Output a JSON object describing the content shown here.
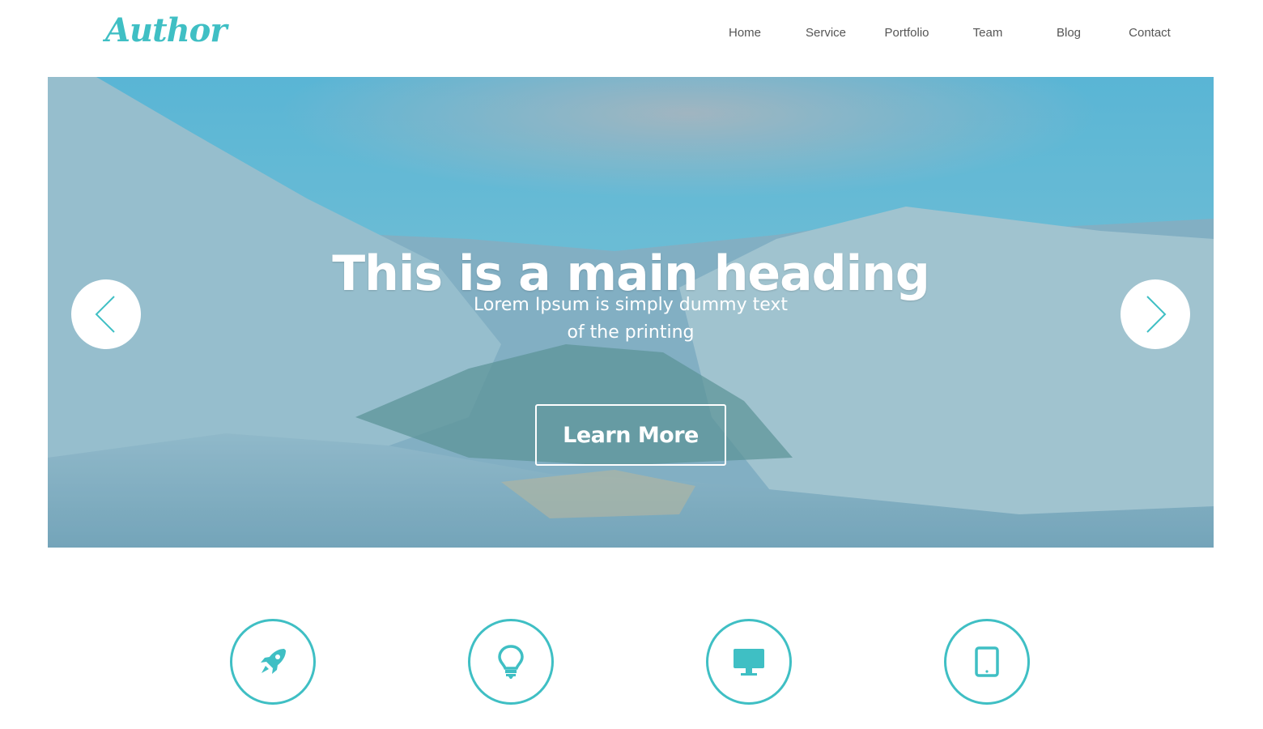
{
  "brand": {
    "logo_text": "Author",
    "accent_color": "#3fbfc4"
  },
  "nav": {
    "items": [
      {
        "label": "Home"
      },
      {
        "label": "Service"
      },
      {
        "label": "Portfolio"
      },
      {
        "label": "Team"
      },
      {
        "label": "Blog"
      },
      {
        "label": "Contact"
      }
    ]
  },
  "hero": {
    "heading": "This is a main heading",
    "subtext_line1": "Lorem Ipsum is simply dummy text",
    "subtext_line2": "of the printing",
    "cta_label": "Learn More",
    "prev_icon": "chevron-left-icon",
    "next_icon": "chevron-right-icon"
  },
  "features": [
    {
      "icon": "rocket-icon"
    },
    {
      "icon": "lightbulb-icon"
    },
    {
      "icon": "desktop-icon"
    },
    {
      "icon": "tablet-icon"
    }
  ]
}
